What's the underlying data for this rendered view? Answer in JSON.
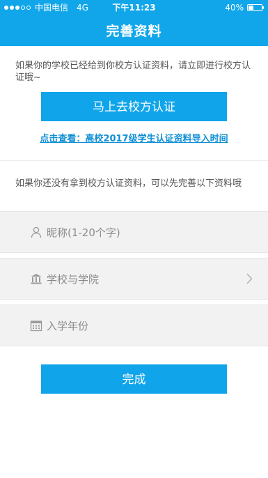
{
  "status_bar": {
    "carrier": "中国电信",
    "network": "4G",
    "time": "下午11:23",
    "battery": "40%",
    "battery_level": 0.4
  },
  "header": {
    "title": "完善资料"
  },
  "verify": {
    "hint": "如果你的学校已经给到你校方认证资料，请立即进行校方认证哦~",
    "button_label": "马上去校方认证",
    "link_text": "点击查看：高校2017级学生认证资料导入时间"
  },
  "profile": {
    "hint": "如果你还没有拿到校方认证资料，可以先完善以下资料哦",
    "fields": [
      {
        "label": "昵称(1-20个字)",
        "icon": "person-icon"
      },
      {
        "label": "学校与学院",
        "icon": "school-icon"
      },
      {
        "label": "入学年份",
        "icon": "calendar-icon"
      }
    ],
    "done_label": "完成"
  },
  "colors": {
    "accent": "#11a6ea",
    "link": "#0f8fd6",
    "field_bg": "#f2f2f2"
  }
}
